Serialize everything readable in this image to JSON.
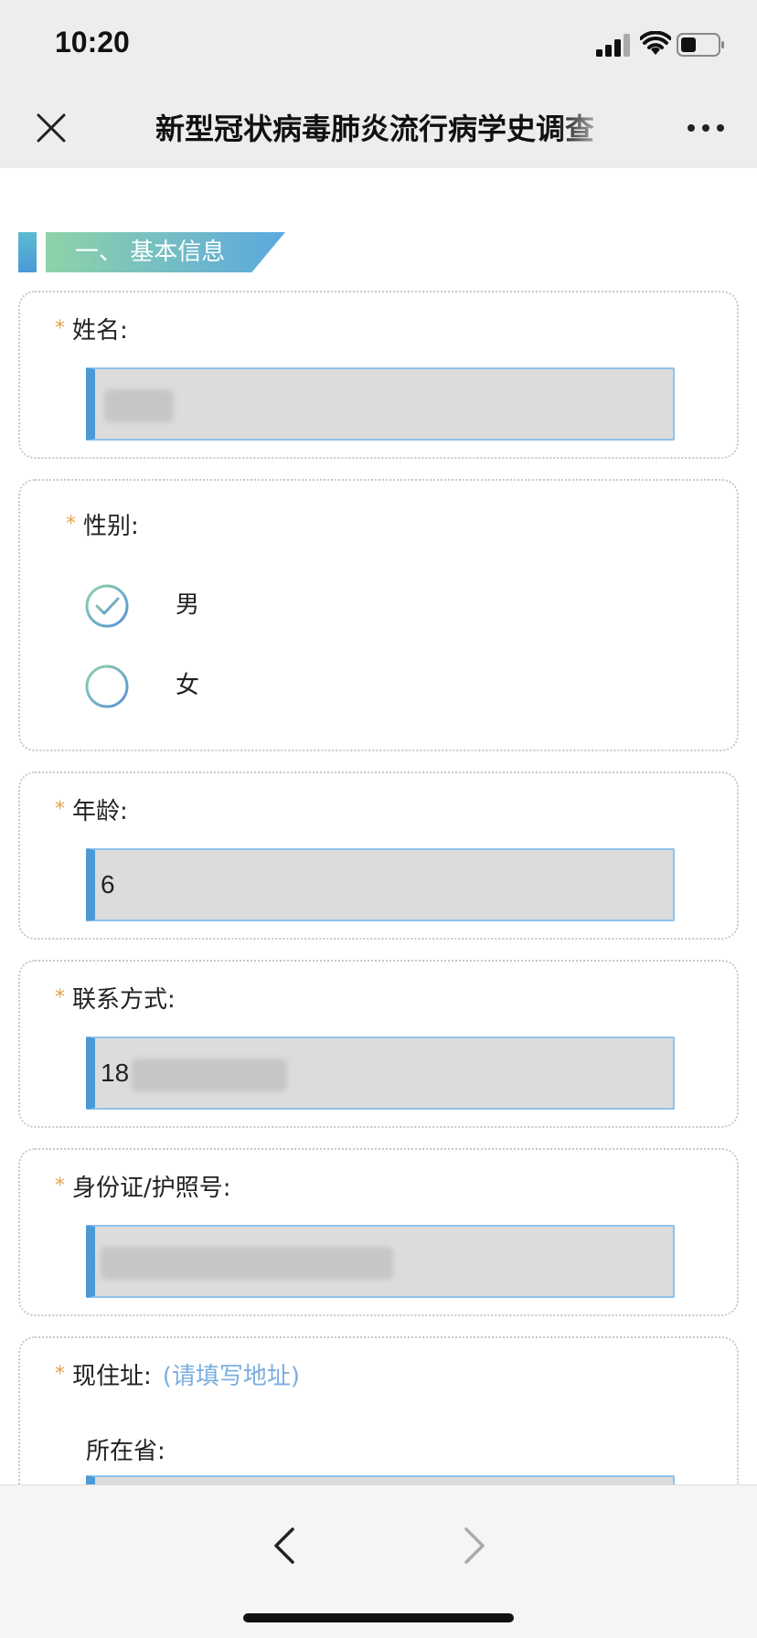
{
  "status_bar": {
    "time": "10:20"
  },
  "nav": {
    "title": "新型冠状病毒肺炎流行病学史调查"
  },
  "section": {
    "title": "一、 基本信息"
  },
  "fields": {
    "name": {
      "label": "姓名:",
      "value": ""
    },
    "gender": {
      "label": "性别:",
      "options": [
        "男",
        "女"
      ],
      "selected": "男"
    },
    "age": {
      "label": "年龄:",
      "value": "6"
    },
    "contact": {
      "label": "联系方式:",
      "value": "18"
    },
    "id_number": {
      "label": "身份证/护照号:",
      "value": ""
    },
    "address": {
      "label": "现住址:",
      "hint": "(请填写地址)",
      "province_label": "所在省:"
    }
  },
  "colors": {
    "accent": "#4a9ad8",
    "required": "#e8a24a",
    "hint": "#7aaee0"
  }
}
